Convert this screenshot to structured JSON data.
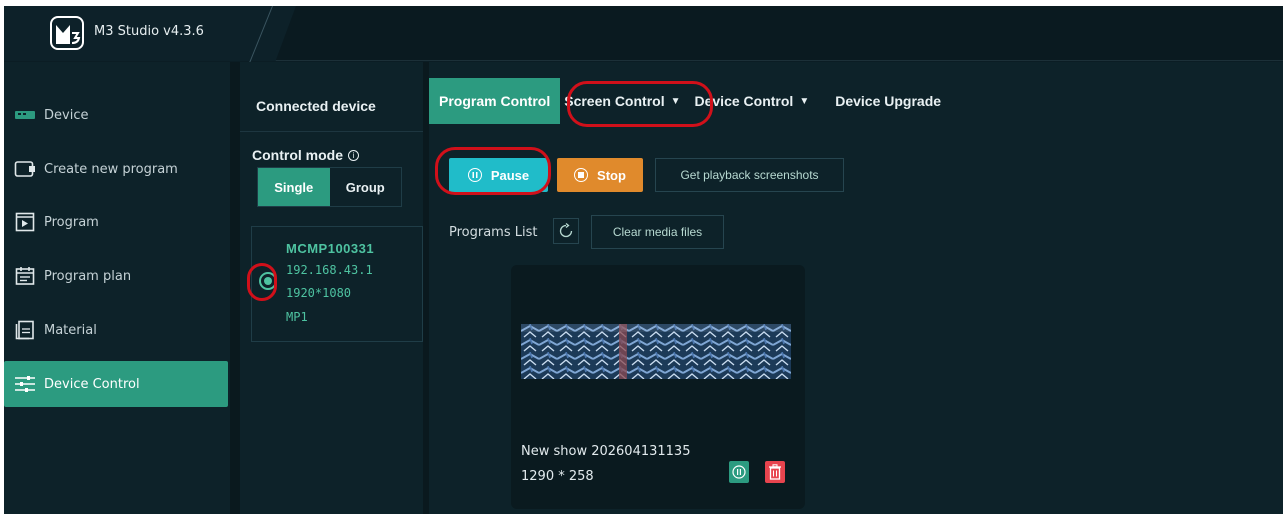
{
  "app": {
    "title": "M3 Studio v4.3.6"
  },
  "sidebar": {
    "items": [
      {
        "label": "Device",
        "icon": "device-icon",
        "active": false
      },
      {
        "label": "Create new program",
        "icon": "create-program-icon",
        "active": false
      },
      {
        "label": "Program",
        "icon": "program-icon",
        "active": false
      },
      {
        "label": "Program plan",
        "icon": "calendar-icon",
        "active": false
      },
      {
        "label": "Material",
        "icon": "material-icon",
        "active": false
      },
      {
        "label": "Device Control",
        "icon": "sliders-icon",
        "active": true
      }
    ]
  },
  "devices": {
    "title": "Connected device",
    "control_mode_label": "Control mode",
    "mode_single": "Single",
    "mode_group": "Group",
    "selected_mode": "Single",
    "device": {
      "name": "MCMP100331",
      "ip": "192.168.43.1",
      "resolution": "1920*1080",
      "model": "MP1"
    }
  },
  "tabs": [
    {
      "label": "Program Control",
      "active": true,
      "dropdown": false
    },
    {
      "label": "Screen Control",
      "active": false,
      "dropdown": true
    },
    {
      "label": "Device Control",
      "active": false,
      "dropdown": true
    },
    {
      "label": "Device Upgrade",
      "active": false,
      "dropdown": false
    }
  ],
  "controls": {
    "pause_label": "Pause",
    "stop_label": "Stop",
    "screenshots_label": "Get playback screenshots"
  },
  "programs": {
    "list_label": "Programs List",
    "clear_label": "Clear media files",
    "items": [
      {
        "name": "New show 202604131135",
        "size": "1290 * 258"
      }
    ]
  },
  "colors": {
    "accent": "#2c9b80",
    "pause": "#20bcc9",
    "stop": "#e08a2c",
    "delete": "#e8444e",
    "annotation": "#d0101a",
    "background": "#0d2229"
  }
}
